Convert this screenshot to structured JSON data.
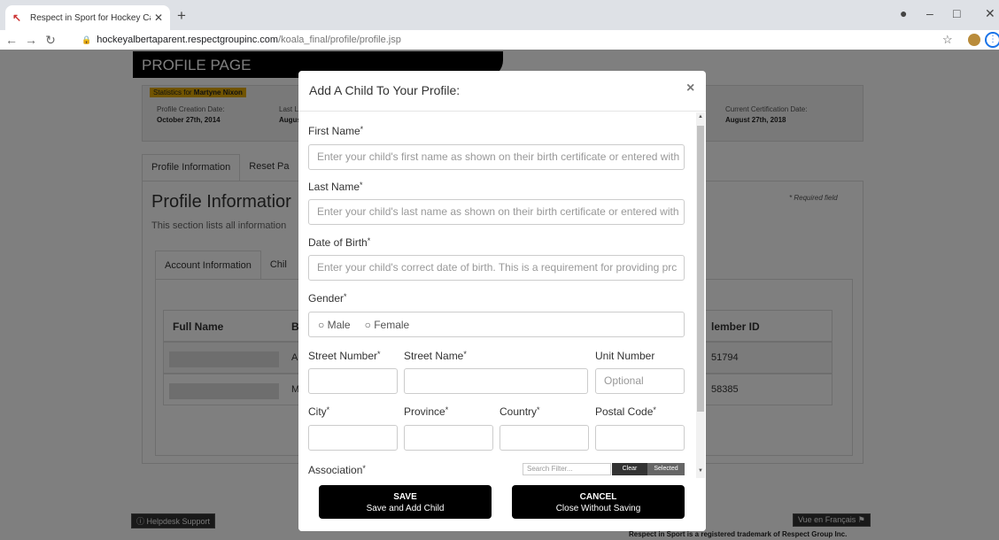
{
  "browser": {
    "tab_title": "Respect in Sport for Hockey Can",
    "url_host": "hockeyalbertaparent.respectgroupinc.com",
    "url_path": "/koala_final/profile/profile.jsp"
  },
  "page": {
    "banner": "PROFILE PAGE",
    "stats": {
      "badge_prefix": "Statistics for ",
      "badge_name": "Martyne Nixon",
      "creation_label": "Profile Creation Date:",
      "creation_value": "October 27th, 2014",
      "last_label": "Last L",
      "last_value": "Augus",
      "cert_label": "Current Certification Date:",
      "cert_value": "August 27th, 2018"
    },
    "tabs": [
      "Profile Information",
      "Reset Pa"
    ],
    "section_title": "Profile Informatior",
    "section_desc": "This section lists all information",
    "required_note": "* Required field",
    "account_tabs": [
      "Account Information",
      "Chil"
    ],
    "table": {
      "headers": [
        "Full Name",
        "B",
        "lember ID"
      ],
      "rows": [
        {
          "col2": "A",
          "col3": "51794"
        },
        {
          "col2": "M",
          "col3": "58385"
        }
      ]
    },
    "helpdesk": "Helpdesk Support",
    "vue": "Vue en Français",
    "trademark": "Respect in Sport is a registered trademark of Respect Group Inc."
  },
  "modal": {
    "title": "Add A Child To Your Profile:",
    "close": "×",
    "first_name_label": "First Name",
    "first_name_placeholder": "Enter your child's first name as shown on their birth certificate or entered with",
    "last_name_label": "Last Name",
    "last_name_placeholder": "Enter your child's last name as shown on their birth certificate or entered with",
    "dob_label": "Date of Birth",
    "dob_placeholder": "Enter your child's correct date of birth.  This is a requirement for providing prc",
    "gender_label": "Gender",
    "gender_options": [
      "Male",
      "Female"
    ],
    "street_number_label": "Street Number",
    "street_name_label": "Street Name",
    "unit_number_label": "Unit Number",
    "unit_number_placeholder": "Optional",
    "city_label": "City",
    "province_label": "Province",
    "country_label": "Country",
    "postal_label": "Postal Code",
    "association_label": "Association",
    "search_filter_placeholder": "Search Filter...",
    "clear_label": "Clear",
    "selected_label": "Selected",
    "required_mark": "*",
    "save_title": "SAVE",
    "save_sub": "Save and Add Child",
    "cancel_title": "CANCEL",
    "cancel_sub": "Close Without Saving"
  }
}
